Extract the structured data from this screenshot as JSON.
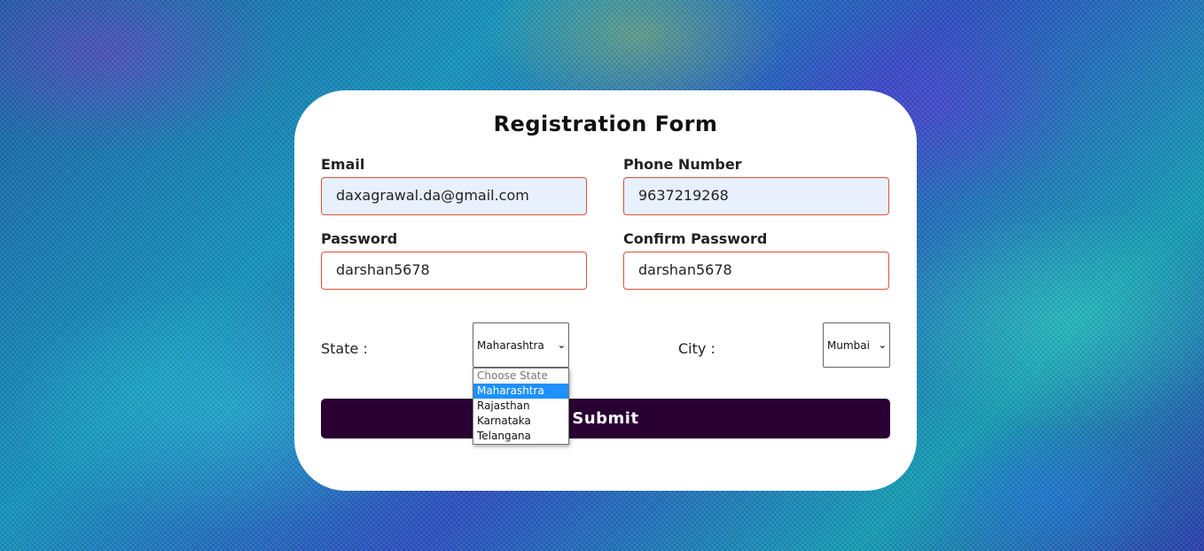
{
  "form": {
    "title": "Registration Form",
    "email": {
      "label": "Email",
      "value": "daxagrawal.da@gmail.com"
    },
    "phone": {
      "label": "Phone Number",
      "value": "9637219268"
    },
    "password": {
      "label": "Password",
      "value": "darshan5678"
    },
    "confirm_password": {
      "label": "Confirm Password",
      "value": "darshan5678"
    },
    "state": {
      "label": "State :",
      "selected": "Maharashtra",
      "options": [
        "Choose State",
        "Maharashtra",
        "Rajasthan",
        "Karnataka",
        "Telangana"
      ],
      "highlighted_index": 1
    },
    "city": {
      "label": "City :",
      "selected": "Mumbai"
    },
    "submit_label": "Submit"
  },
  "colors": {
    "submit_bg": "#2a0033",
    "input_border": "#d9533a",
    "autofill_bg": "#e8f0fe",
    "option_highlight": "#1e90ff"
  },
  "icons": {
    "select_arrow": "chevron-down-icon"
  }
}
